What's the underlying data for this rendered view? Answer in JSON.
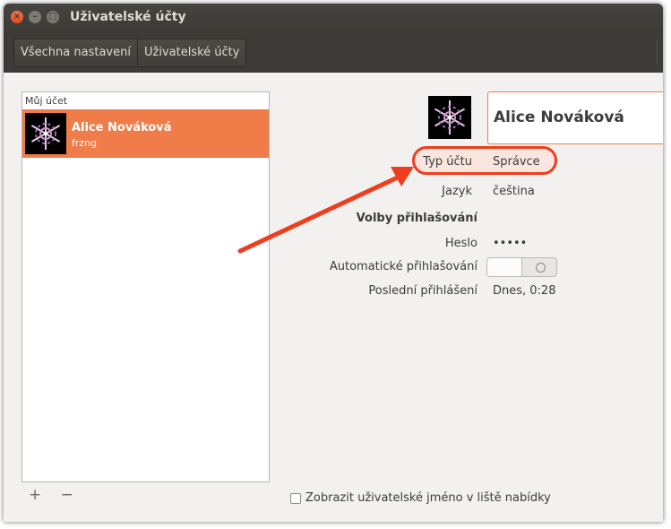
{
  "window": {
    "title": "Uživatelské účty",
    "close_glyph": "×",
    "min_glyph": "–",
    "max_glyph": "□"
  },
  "toolbar": {
    "crumbs": [
      "Všechna nastavení",
      "Uživatelské účty"
    ]
  },
  "user_list": {
    "header": "Můj účet",
    "rows": [
      {
        "name": "Alice Nováková",
        "username": "frzng",
        "selected": true
      }
    ],
    "add_glyph": "+",
    "remove_glyph": "−"
  },
  "account": {
    "full_name": "Alice Nováková",
    "type_label": "Typ účtu",
    "type_value": "Správce",
    "language_label": "Jazyk",
    "language_value": "čeština",
    "login_options_heading": "Volby přihlašování",
    "password_label": "Heslo",
    "password_value": "•••••",
    "autologin_label": "Automatické přihlašování",
    "autologin_on": false,
    "last_login_label": "Poslední přihlášení",
    "last_login_value": "Dnes, 0:28"
  },
  "footer": {
    "show_username_label": "Zobrazit uživatelské jméno v liště nabídky",
    "show_username_checked": false
  },
  "colors": {
    "accent": "#ef7c49",
    "annotation": "#ef3d1e",
    "titlebar": "#3c3b37"
  }
}
